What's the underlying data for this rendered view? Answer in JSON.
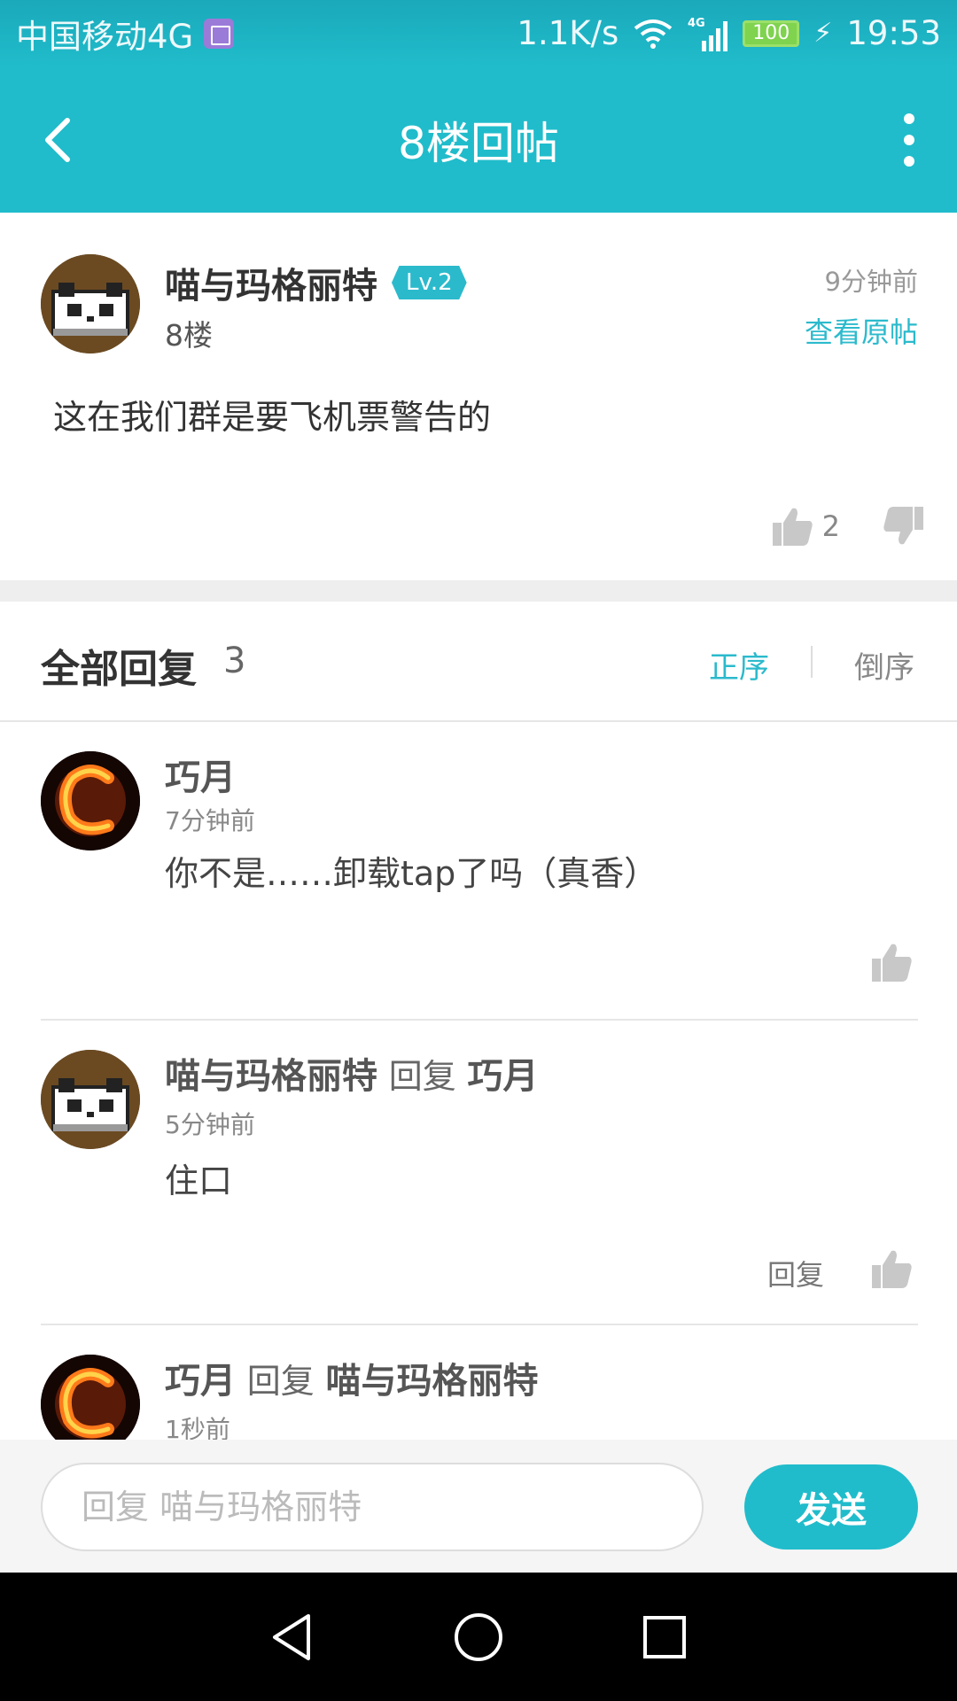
{
  "status_bar": {
    "carrier": "中国移动4G",
    "speed": "1.1K/s",
    "network": "4G",
    "battery": "100",
    "time": "19:53"
  },
  "header": {
    "title": "8楼回帖"
  },
  "post": {
    "username": "喵与玛格丽特",
    "level": "Lv.2",
    "floor": "8楼",
    "time": "9分钟前",
    "view_original": "查看原帖",
    "content": "这在我们群是要飞机票警告的",
    "likes": "2"
  },
  "replies_section": {
    "title": "全部回复",
    "count": "3",
    "sort_asc": "正序",
    "sort_desc": "倒序"
  },
  "replies": [
    {
      "author": "巧月",
      "verb": "",
      "target": "",
      "time": "7分钟前",
      "text": "你不是……卸载tap了吗（真香）"
    },
    {
      "author": "喵与玛格丽特",
      "verb": "回复",
      "target": "巧月",
      "time": "5分钟前",
      "text": "住口",
      "reply_label": "回复"
    },
    {
      "author": "巧月",
      "verb": "回复",
      "target": "喵与玛格丽特",
      "time": "1秒前",
      "text": ""
    }
  ],
  "input_bar": {
    "placeholder": "回复 喵与玛格丽特",
    "value": "",
    "send_label": "发送"
  },
  "colors": {
    "accent": "#20bccb",
    "link": "#2bbacc"
  },
  "icons": {
    "back": "back-arrow-icon",
    "more": "more-vertical-icon",
    "like": "thumbs-up-icon",
    "dislike": "thumbs-down-icon"
  }
}
